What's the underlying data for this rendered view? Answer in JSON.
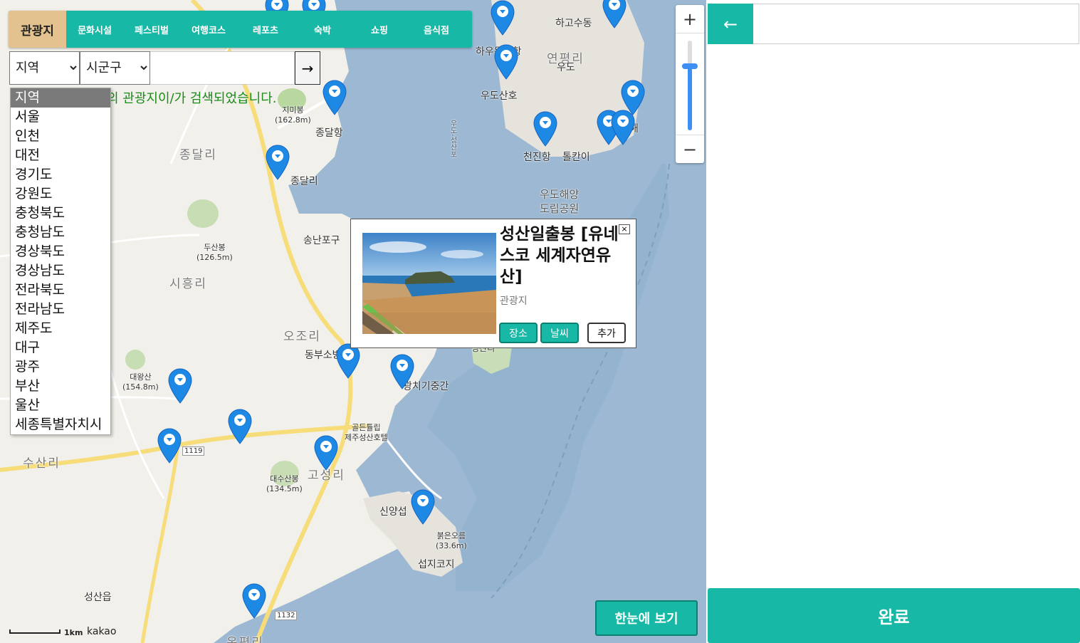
{
  "tabs": [
    {
      "label": "관광지",
      "active": true
    },
    {
      "label": "문화시설",
      "active": false
    },
    {
      "label": "페스티벌",
      "active": false
    },
    {
      "label": "여행코스",
      "active": false
    },
    {
      "label": "레포츠",
      "active": false
    },
    {
      "label": "숙박",
      "active": false
    },
    {
      "label": "쇼핑",
      "active": false
    },
    {
      "label": "음식점",
      "active": false
    }
  ],
  "search": {
    "region_selected": "지역",
    "district_selected": "시군구",
    "go_label": "→"
  },
  "result_message": "의 관광지이/가 검색되었습니다.",
  "region_options": [
    "지역",
    "서울",
    "인천",
    "대전",
    "경기도",
    "강원도",
    "충청북도",
    "충청남도",
    "경상북도",
    "경상남도",
    "전라북도",
    "전라남도",
    "제주도",
    "대구",
    "광주",
    "부산",
    "울산",
    "세종특별자치시"
  ],
  "map_labels": {
    "jimibong": "지미봉",
    "jimibong_h": "(162.8m)",
    "jongdalhang": "종달항",
    "jongdalri_big": "종달리",
    "jongdalri": "종달리",
    "songnanpo": "송난포구",
    "dusanbong": "두산봉",
    "dusanbong_h": "(126.5m)",
    "siheungri": "시흥리",
    "ojori": "오조리",
    "dongbusobang": "동부소방",
    "daewangsan": "대왕산",
    "daewangsan_h": "(154.8m)",
    "susanri": "수산리",
    "road_1119": "1119",
    "golden_tulip": "골든튤립",
    "golden_tulip2": "제주성산호텔",
    "daesusanbong": "대수산봉",
    "daesusanbong_h": "(134.5m)",
    "goseongri": "고성리",
    "sinyang": "신양섭",
    "bulgeunoreum": "붉은오름",
    "bulgeunoreum_h": "(33.6m)",
    "seopjikoji": "섭지코지",
    "seongsaneup": "성산읍",
    "road_1132": "1132",
    "ohpyeongri": "온평리",
    "gwangchigi": "광치기중간",
    "seongsanri": "성산리",
    "hagosudong": "하고수동",
    "hauemokdong": "하우목동항",
    "yeonpyeongri": "연평리",
    "udo": "우도",
    "udosanho": "우도산호",
    "cheonjinhang": "천진항",
    "tolkani": "톨칸이",
    "udo_park1": "우도해양",
    "udo_park2": "도립공원",
    "ferry_route": "우도-성산포",
    "beach_right": "해"
  },
  "popup": {
    "title": "성산일출봉 [유네스코 세계자연유산]",
    "category": "관광지",
    "close": "×",
    "btn_place": "장소",
    "btn_weather": "날씨",
    "btn_add": "추가"
  },
  "zoom": {
    "in": "+",
    "out": "−",
    "level_fraction": 0.48
  },
  "overview_button": "한눈에 보기",
  "scale_label": "1km",
  "map_logo": "kakao",
  "panel": {
    "back": "←",
    "done": "완료",
    "input_value": ""
  },
  "colors": {
    "accent": "#17b8a6",
    "active_tab": "#e4c28f",
    "pin": "#1e88e5",
    "water": "#9cb8d2"
  }
}
